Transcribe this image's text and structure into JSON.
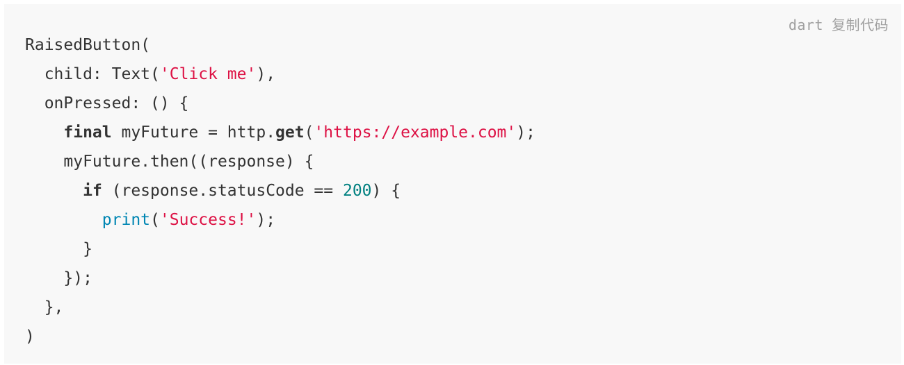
{
  "header": {
    "language": "dart",
    "copy_label": "复制代码"
  },
  "colors": {
    "background": "#f8f8f8",
    "string": "#d14",
    "number": "#008080",
    "builtin": "#0086b3",
    "text": "#333333",
    "header_text": "#a0a0a0"
  },
  "code": {
    "lines": [
      [
        {
          "t": "RaisedButton(",
          "k": "plain"
        }
      ],
      [
        {
          "t": "  child: Text(",
          "k": "plain"
        },
        {
          "t": "'Click me'",
          "k": "str"
        },
        {
          "t": "),",
          "k": "plain"
        }
      ],
      [
        {
          "t": "  onPressed: () {",
          "k": "plain"
        }
      ],
      [
        {
          "t": "    ",
          "k": "plain"
        },
        {
          "t": "final",
          "k": "kw"
        },
        {
          "t": " myFuture = http.",
          "k": "plain"
        },
        {
          "t": "get",
          "k": "fn"
        },
        {
          "t": "(",
          "k": "plain"
        },
        {
          "t": "'https://example.com'",
          "k": "str"
        },
        {
          "t": ");",
          "k": "plain"
        }
      ],
      [
        {
          "t": "    myFuture.then((response) {",
          "k": "plain"
        }
      ],
      [
        {
          "t": "      ",
          "k": "plain"
        },
        {
          "t": "if",
          "k": "kw"
        },
        {
          "t": " (response.statusCode == ",
          "k": "plain"
        },
        {
          "t": "200",
          "k": "num"
        },
        {
          "t": ") {",
          "k": "plain"
        }
      ],
      [
        {
          "t": "        ",
          "k": "plain"
        },
        {
          "t": "print",
          "k": "builtin"
        },
        {
          "t": "(",
          "k": "plain"
        },
        {
          "t": "'Success!'",
          "k": "str"
        },
        {
          "t": ");",
          "k": "plain"
        }
      ],
      [
        {
          "t": "      }",
          "k": "plain"
        }
      ],
      [
        {
          "t": "    });",
          "k": "plain"
        }
      ],
      [
        {
          "t": "  },",
          "k": "plain"
        }
      ],
      [
        {
          "t": ")",
          "k": "plain"
        }
      ]
    ]
  }
}
